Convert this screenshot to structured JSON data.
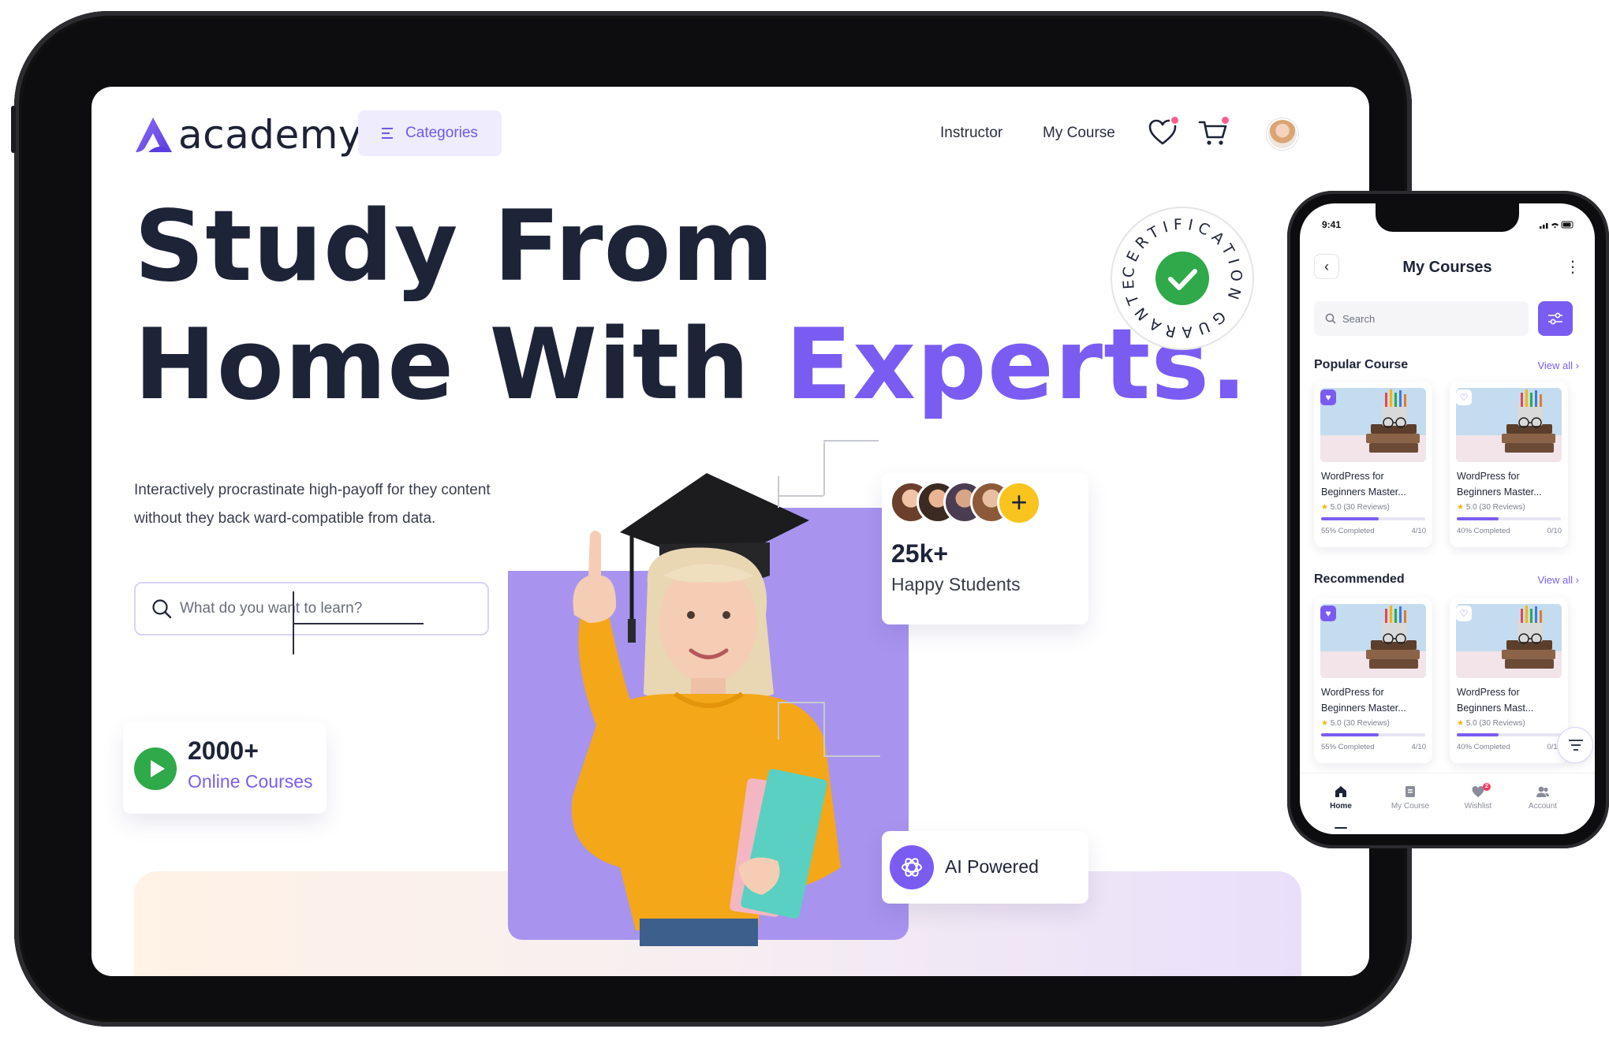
{
  "web": {
    "logo_text": "academy",
    "categories_label": "Categories",
    "nav": {
      "instructor": "Instructor",
      "my_course": "My Course"
    },
    "hero": {
      "line1": "Study From",
      "line2_prefix": "Home With ",
      "line2_accent": "Experts.",
      "description": "Interactively procrastinate high-payoff for they content without they  back ward-compatible from data."
    },
    "search_placeholder": "What do you want to learn?",
    "badge_text": "CERTIFICATION GUARANTEE",
    "stats": {
      "courses_number": "2000+",
      "courses_label": "Online Courses",
      "students_number": "25k+",
      "students_label": "Happy Students",
      "ai_label": "AI Powered"
    }
  },
  "mobile": {
    "status_time": "9:41",
    "title": "My Courses",
    "search_placeholder": "Search",
    "popular": {
      "heading": "Popular Course",
      "view_all": "View all"
    },
    "recommended": {
      "heading": "Recommended",
      "view_all": "View all"
    },
    "cards": [
      {
        "title": "WordPress for Beginners Master...",
        "rating": "5.0 (30 Reviews)",
        "progress_label": "55% Completed",
        "count": "4/10",
        "progress": 0.55
      },
      {
        "title": "WordPress for Beginners Master...",
        "rating": "5.0 (30 Reviews)",
        "progress_label": "40% Completed",
        "count": "0/10",
        "progress": 0.4
      },
      {
        "title": "WordPress for Beginners Master...",
        "rating": "5.0 (30 Reviews)",
        "progress_label": "55% Completed",
        "count": "4/10",
        "progress": 0.55
      },
      {
        "title": "WordPress for Beginners Mast...",
        "rating": "5.0 (30 Reviews)",
        "progress_label": "40% Completed",
        "count": "0/10",
        "progress": 0.4
      }
    ],
    "tabs": {
      "home": "Home",
      "my_course": "My Course",
      "wishlist": "Wishlist",
      "account": "Account"
    },
    "wishlist_badge": "2"
  },
  "colors": {
    "accent": "#7b5cf2",
    "dark": "#1e2437",
    "green": "#2fa94a",
    "yellow": "#f8c41d"
  }
}
